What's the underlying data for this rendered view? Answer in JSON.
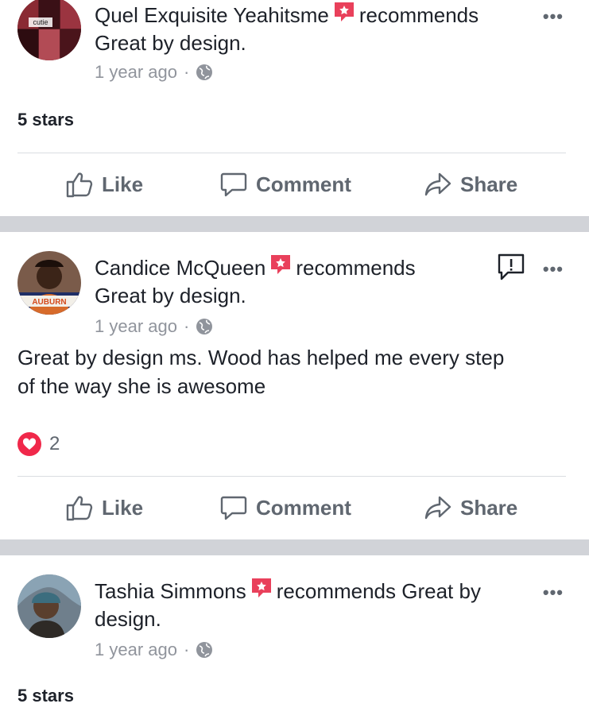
{
  "posts": [
    {
      "author": "Quel Exquisite Yeahitsme",
      "verb": "recommends",
      "page": "Great by design.",
      "time": "1 year ago",
      "rating_text": "5 stars",
      "avatar_text": "cutie"
    },
    {
      "author": "Candice McQueen",
      "verb": "recommends",
      "page": "Great by design.",
      "time": "1 year ago",
      "text": "Great by design ms. Wood has helped me every step of the way she is awesome",
      "reaction_count": "2",
      "avatar_text": "AUBURN"
    },
    {
      "author": "Tashia Simmons",
      "verb": "recommends",
      "page": "Great by design.",
      "time": "1 year ago",
      "rating_text": "5 stars"
    }
  ],
  "actions": {
    "like": "Like",
    "comment": "Comment",
    "share": "Share"
  },
  "separator": "·",
  "more_glyph": "•••",
  "colors": {
    "recommend_red": "#e9405b",
    "love_red": "#f0284a",
    "muted": "#606770",
    "band": "#d1d3d8"
  }
}
